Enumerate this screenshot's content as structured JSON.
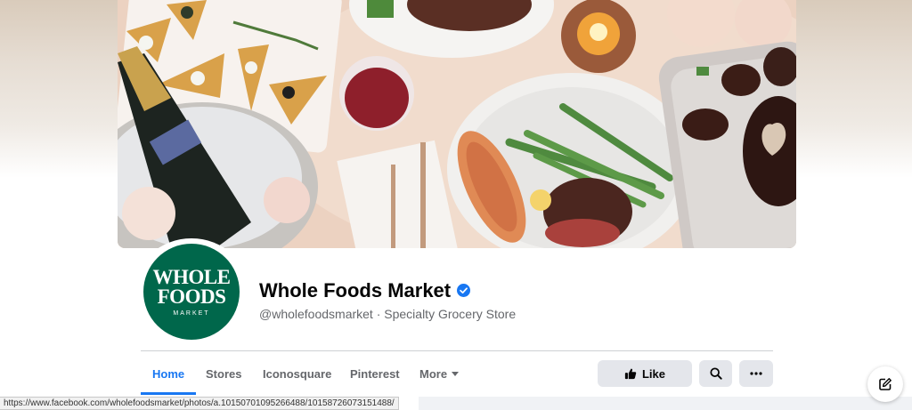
{
  "page": {
    "name": "Whole Foods Market",
    "handle_line": "@wholefoodsmarket · Specialty Grocery Store",
    "verified": true
  },
  "logo": {
    "line1": "WHOLE",
    "line2": "FOODS",
    "line3": "MARKET",
    "color": "#00674b"
  },
  "tabs": [
    {
      "label": "Home",
      "active": true
    },
    {
      "label": "Stores",
      "active": false
    },
    {
      "label": "Iconosquare",
      "active": false
    },
    {
      "label": "Pinterest",
      "active": false
    },
    {
      "label": "More",
      "active": false
    }
  ],
  "actions": {
    "like_label": "Like",
    "like_icon": "thumbs-up-icon",
    "search_icon": "search-icon",
    "more_icon": "ellipsis-icon"
  },
  "status_bar": {
    "url": "https://www.facebook.com/wholefoodsmarket/photos/a.10150701095266488/10158726073151488/"
  },
  "floating": {
    "icon": "compose-icon"
  },
  "colors": {
    "accent": "#1877f2",
    "button_bg": "#e4e6eb",
    "muted_text": "#65676b"
  }
}
